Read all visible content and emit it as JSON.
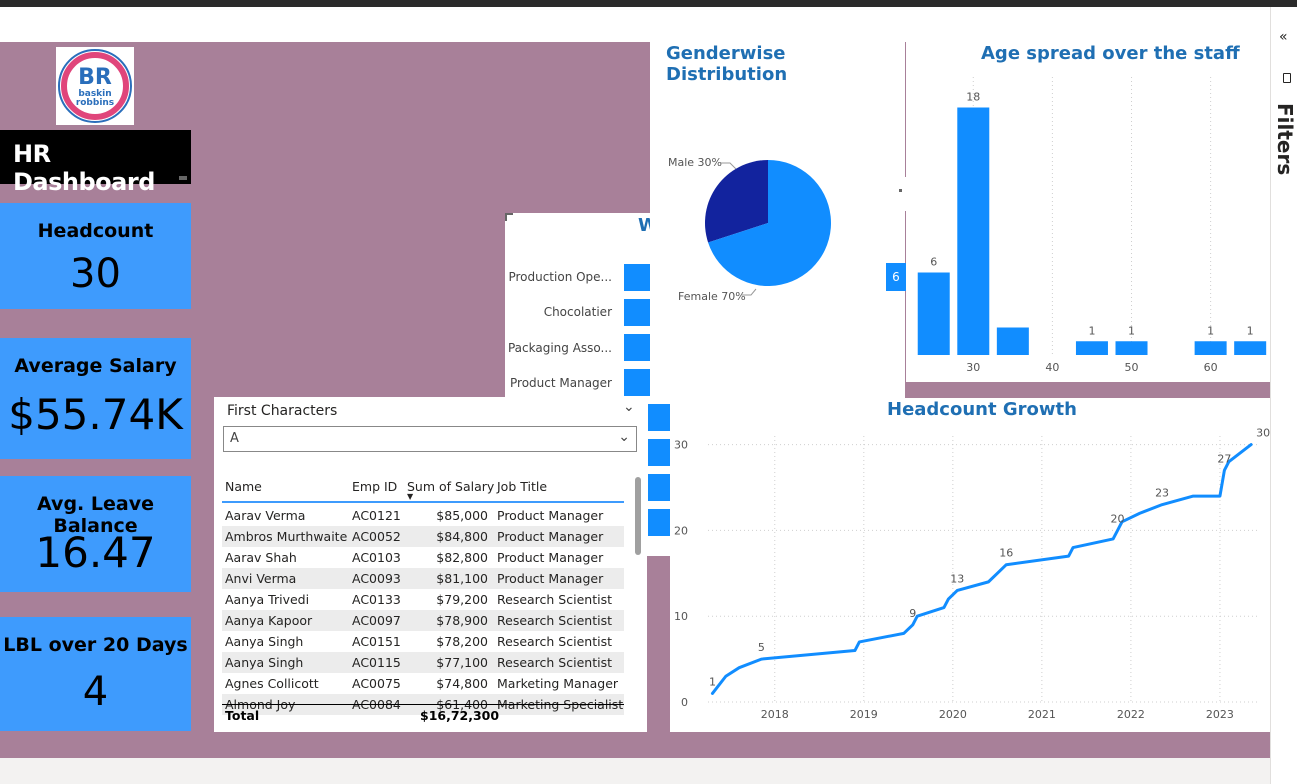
{
  "brand": {
    "logo_text_line1": "baskin",
    "logo_text_line2": "robbins",
    "logo_monogram": "BR"
  },
  "dashboard_title": "HR Dashboard",
  "kpis": [
    {
      "label": "Headcount",
      "value": "30"
    },
    {
      "label": "Average Salary",
      "value": "$55.74K"
    },
    {
      "label": "Avg. Leave Balance",
      "value": "16.47"
    },
    {
      "label": "LBL over 20 Days",
      "value": "4"
    }
  ],
  "filters_pane": {
    "label": "Filters",
    "collapse_icon": "double-chevron-left-icon"
  },
  "gender_chart": {
    "title": "Genderwise Distribution",
    "male_label": "Male 30%",
    "female_label": "Female 70%"
  },
  "age_chart": {
    "title": "Age spread over the staff"
  },
  "growth_chart": {
    "title": "Headcount Growth"
  },
  "job_chart": {
    "title_fragment": "W",
    "labels": [
      "Production Ope...",
      "Chocolatier",
      "Packaging Asso...",
      "Product Manager"
    ],
    "side_label": "6"
  },
  "slicer": {
    "label": "First Characters",
    "selected": "A"
  },
  "table": {
    "columns": [
      "Name",
      "Emp ID",
      "Sum of Salary",
      "Job Title"
    ],
    "rows": [
      [
        "Aarav Verma",
        "AC0121",
        "$85,000",
        "Product Manager"
      ],
      [
        "Ambros Murthwaite",
        "AC0052",
        "$84,800",
        "Product Manager"
      ],
      [
        "Aarav Shah",
        "AC0103",
        "$82,800",
        "Product Manager"
      ],
      [
        "Anvi Verma",
        "AC0093",
        "$81,100",
        "Product Manager"
      ],
      [
        "Aanya Trivedi",
        "AC0133",
        "$79,200",
        "Research Scientist"
      ],
      [
        "Aanya Kapoor",
        "AC0097",
        "$78,900",
        "Research Scientist"
      ],
      [
        "Aanya Singh",
        "AC0151",
        "$78,200",
        "Research Scientist"
      ],
      [
        "Aanya Singh",
        "AC0115",
        "$77,100",
        "Research Scientist"
      ],
      [
        "Agnes Collicott",
        "AC0075",
        "$74,800",
        "Marketing Manager"
      ],
      [
        "Almond Joy",
        "AC0084",
        "$61,400",
        "Marketing Specialist"
      ]
    ],
    "total_label": "Total",
    "total_value": "$16,72,300"
  },
  "colors": {
    "accent": "#118dff",
    "dark_blue": "#12239e",
    "background": "#a88099",
    "kpi": "#3e9bfd",
    "title": "#1f6fb3"
  },
  "chart_data": [
    {
      "type": "pie",
      "title": "Genderwise Distribution",
      "categories": [
        "Male",
        "Female"
      ],
      "values": [
        30,
        70
      ],
      "colors": [
        "#12239e",
        "#118dff"
      ]
    },
    {
      "type": "bar",
      "title": "Age spread over the staff",
      "x": [
        25,
        30,
        35,
        45,
        50,
        60,
        65
      ],
      "values": [
        6,
        18,
        2,
        1,
        1,
        1,
        1
      ],
      "data_labels": [
        "6",
        "18",
        "",
        "1",
        "1",
        "1",
        "1"
      ],
      "xticks": [
        "30",
        "40",
        "50",
        "60"
      ],
      "xlim": [
        22,
        67
      ],
      "ylim": [
        0,
        20
      ]
    },
    {
      "type": "line",
      "title": "Headcount Growth",
      "x": [
        2017.3,
        2017.45,
        2017.6,
        2017.85,
        2018.9,
        2018.95,
        2019.45,
        2019.55,
        2019.6,
        2019.9,
        2019.95,
        2020.05,
        2020.4,
        2020.5,
        2020.6,
        2021.3,
        2021.35,
        2021.8,
        2021.85,
        2021.9,
        2022.1,
        2022.35,
        2022.7,
        2023.0,
        2023.05,
        2023.1,
        2023.35
      ],
      "values": [
        1,
        3,
        4,
        5,
        6,
        7,
        8,
        9,
        10,
        11,
        12,
        13,
        14,
        15,
        16,
        17,
        18,
        19,
        20,
        21,
        22,
        23,
        24,
        24,
        27,
        28,
        30
      ],
      "point_labels": [
        {
          "x": 2017.3,
          "y": 1,
          "text": "1"
        },
        {
          "x": 2017.85,
          "y": 5,
          "text": "5"
        },
        {
          "x": 2019.55,
          "y": 9,
          "text": "9"
        },
        {
          "x": 2020.05,
          "y": 13,
          "text": "13"
        },
        {
          "x": 2020.6,
          "y": 16,
          "text": "16"
        },
        {
          "x": 2021.85,
          "y": 20,
          "text": "20"
        },
        {
          "x": 2022.35,
          "y": 23,
          "text": "23"
        },
        {
          "x": 2023.05,
          "y": 27,
          "text": "27"
        },
        {
          "x": 2023.35,
          "y": 30,
          "text": "30"
        }
      ],
      "xticks": [
        "2018",
        "2019",
        "2020",
        "2021",
        "2022",
        "2023"
      ],
      "yticks": [
        "0",
        "10",
        "20",
        "30"
      ],
      "xlim": [
        2017.25,
        2023.45
      ],
      "ylim": [
        0,
        31
      ]
    }
  ]
}
